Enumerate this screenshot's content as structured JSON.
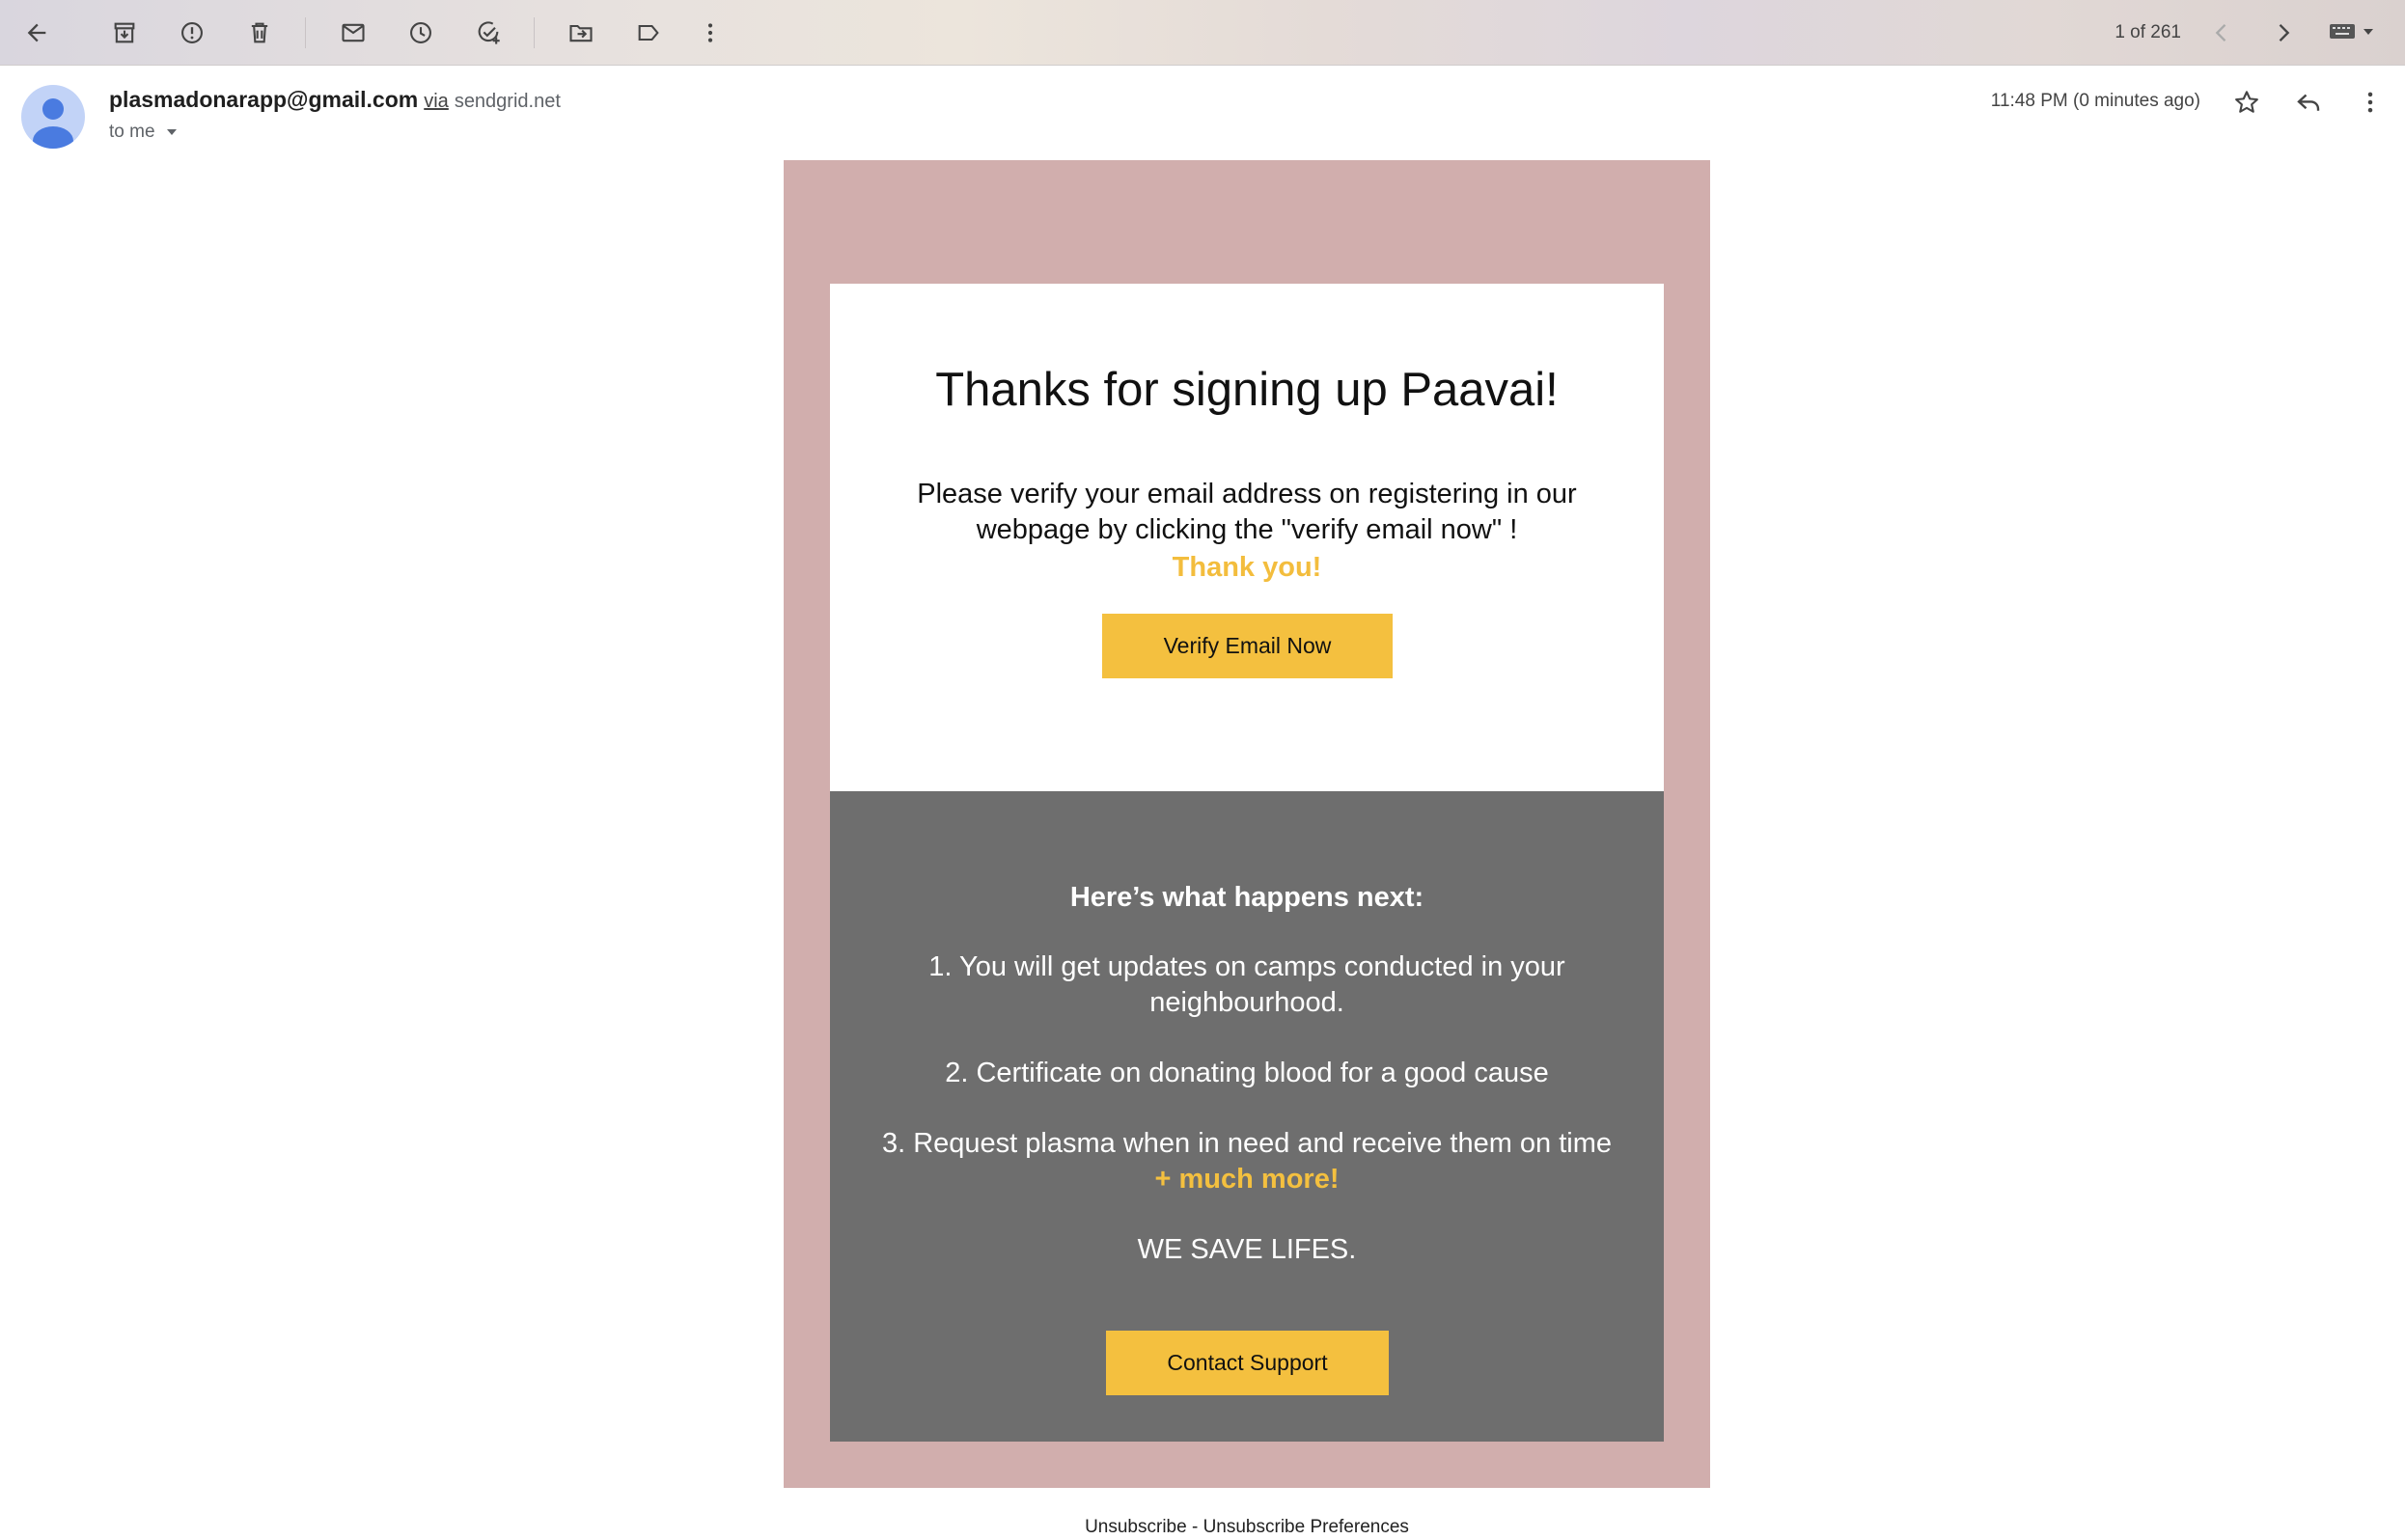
{
  "toolbar": {
    "icons": [
      "back-arrow-icon",
      "archive-icon",
      "report-spam-icon",
      "delete-icon",
      "mark-unread-icon",
      "snooze-icon",
      "add-task-icon",
      "move-to-icon",
      "label-icon",
      "more-vertical-icon"
    ],
    "page_count": "1 of 261",
    "nav_icons": [
      "chevron-left-icon",
      "chevron-right-icon"
    ],
    "input_tools_icon": "keyboard-icon"
  },
  "header": {
    "sender_email": "plasmadonarapp@gmail.com",
    "via_label": "via",
    "via_domain": "sendgrid.net",
    "to_label": "to me",
    "timestamp": "11:48 PM (0 minutes ago)",
    "action_icons": [
      "star-icon",
      "reply-icon",
      "more-vertical-icon"
    ]
  },
  "email": {
    "title": "Thanks for signing up Paavai!",
    "message": "Please verify your email address on registering in our webpage by clicking the \"verify email now\" !",
    "thanks": "Thank you!",
    "verify_button": "Verify Email Now",
    "next_heading": "Here’s what happens next:",
    "list": [
      "1. You will get updates on camps conducted in your neighbourhood.",
      "2.  Certificate on donating blood for a good cause",
      "3. Request plasma when in need and receive them on time"
    ],
    "more": "+ much more!",
    "slogan": "WE SAVE LIFES.",
    "support_button": "Contact Support"
  },
  "footer": {
    "unsubscribe": "Unsubscribe",
    "separator": " - ",
    "preferences": "Unsubscribe Preferences"
  },
  "colors": {
    "frame": "#d1aead",
    "accent_yellow": "#f4c03f",
    "grey_panel": "#6e6e6e",
    "avatar_bg": "#c2d3f7",
    "avatar_fg": "#4a7be0"
  }
}
